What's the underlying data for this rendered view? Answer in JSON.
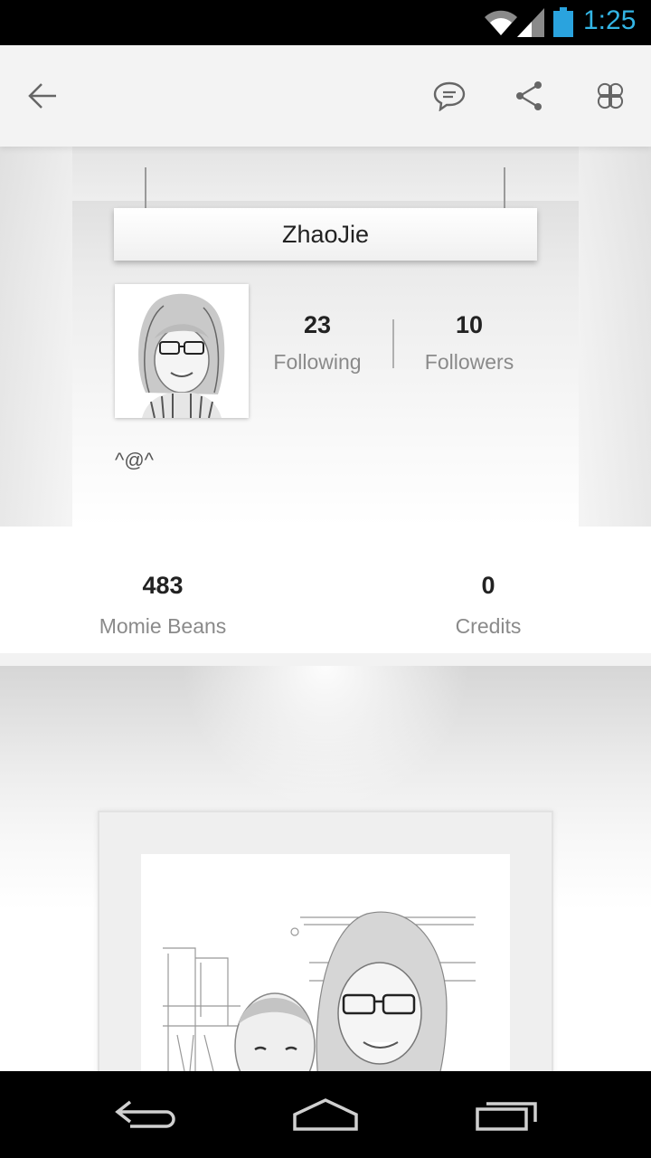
{
  "status_bar": {
    "time": "1:25"
  },
  "profile": {
    "name": "ZhaoJie",
    "bio": "^@^",
    "following": {
      "count": "23",
      "label": "Following"
    },
    "followers": {
      "count": "10",
      "label": "Followers"
    },
    "beans": {
      "count": "483",
      "label": "Momie Beans"
    },
    "credits": {
      "count": "0",
      "label": "Credits"
    }
  },
  "icons": {
    "back": "arrow-left-icon",
    "comment": "chat-bubble-icon",
    "share": "share-icon",
    "menu": "four-leaf-grid-icon"
  },
  "colors": {
    "accent": "#33b5e5",
    "battery": "#2aa3de"
  }
}
